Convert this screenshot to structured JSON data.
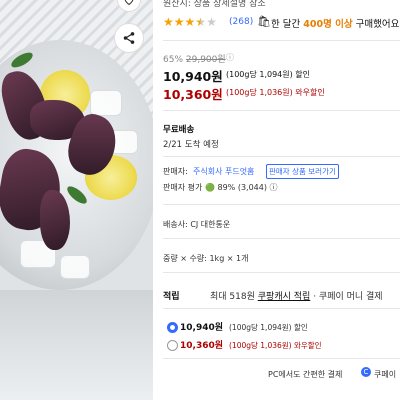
{
  "product": {
    "brand_line": "원산지: 상품 상세설명 참조",
    "rating": 3.5,
    "review_count": "(268)",
    "recent_buyers_pre": "한 달간",
    "recent_buyers_count": "400명 이상",
    "recent_buyers_post": "구매했어요"
  },
  "price": {
    "discount_rate": "65%",
    "original_price": "29,900원",
    "info_icon": "ⓘ",
    "sale_price": "10,940원",
    "sale_unit": "(100g당 1,094원) 할인",
    "wow_price": "10,360원",
    "wow_unit": "(100g당 1,036원) 와우할인"
  },
  "shipping": {
    "label": "무료배송",
    "eta": "2/21 도착 예정"
  },
  "seller": {
    "label": "판매자:",
    "name": "주식회사 푸드엇홈",
    "other_button": "판매자 상품 보러가기",
    "eval_label": "판매자 평가",
    "eval_value": "🟢 89% (3,044) ⓘ"
  },
  "delivery": {
    "text": "배송사: CJ 대한통운"
  },
  "option": {
    "text": "중량 × 수량: 1kg × 1개"
  },
  "earn": {
    "label": "적립",
    "text_pre": "최대 518원",
    "cash": "쿠팡캐시 적립",
    "text_post": "· 쿠페이 머니 결제"
  },
  "purchase_options": [
    {
      "price": "10,940원",
      "unit": "(100g당 1,094원)",
      "tag": "할인",
      "selected": true
    },
    {
      "price": "10,360원",
      "unit": "(100g당 1,036원)",
      "tag": "와우할인",
      "selected": false
    }
  ],
  "footer": {
    "pc_text": "PC에서도 간편한 결제",
    "pay_icon": "C",
    "pay_text": "쿠페이"
  },
  "icons": {
    "favorite": "heart-icon",
    "share": "share-icon",
    "bag": "shopping-bag-icon"
  },
  "colors": {
    "accent_blue": "#346aff",
    "wow_red": "#ae0000",
    "star": "#f4a300",
    "buyers_orange": "#e67e00"
  }
}
